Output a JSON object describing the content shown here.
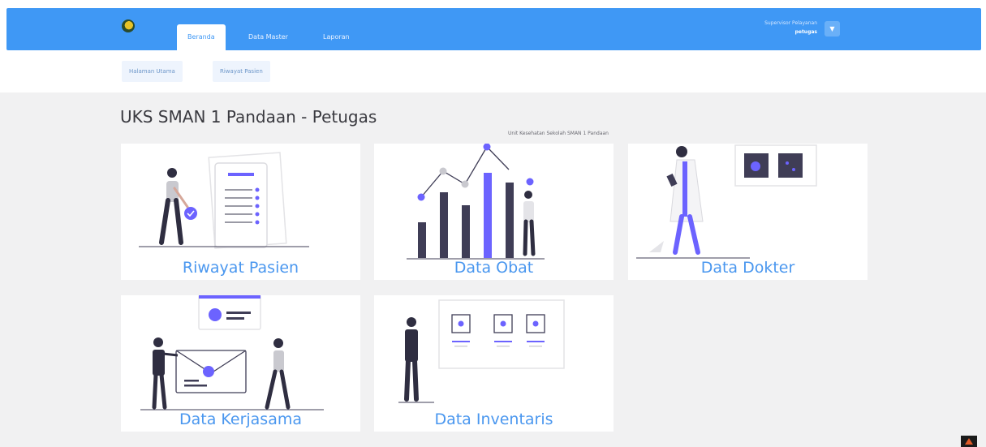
{
  "header": {
    "logo_icon": "school-emblem-icon",
    "nav": [
      {
        "label": "Beranda",
        "active": true
      },
      {
        "label": "Data Master",
        "active": false
      },
      {
        "label": "Laporan",
        "active": false
      }
    ],
    "user": {
      "name": "Supervisor Pelayanan",
      "role": "petugas",
      "toggle_icon": "chevron-down-icon"
    }
  },
  "subnav": [
    "Halaman Utama",
    "Riwayat Pasien"
  ],
  "main": {
    "title": "UKS SMAN 1 Pandaan - Petugas",
    "subtitle": "Unit Kesehatan Sekolah SMAN 1 Pandaan",
    "cards": [
      {
        "label": "Riwayat Pasien",
        "illustration": "patient-history-illustration"
      },
      {
        "label": "Data Obat",
        "illustration": "bar-chart-illustration"
      },
      {
        "label": "Data Dokter",
        "illustration": "doctor-illustration"
      },
      {
        "label": "Data Kerjasama",
        "illustration": "partnership-illustration"
      },
      {
        "label": "Data Inventaris",
        "illustration": "inventory-illustration"
      }
    ]
  },
  "colors": {
    "topbar": "#3f98f5",
    "accent": "#6c63ff",
    "card_label": "#4a97ef",
    "background": "#f1f1f2"
  }
}
